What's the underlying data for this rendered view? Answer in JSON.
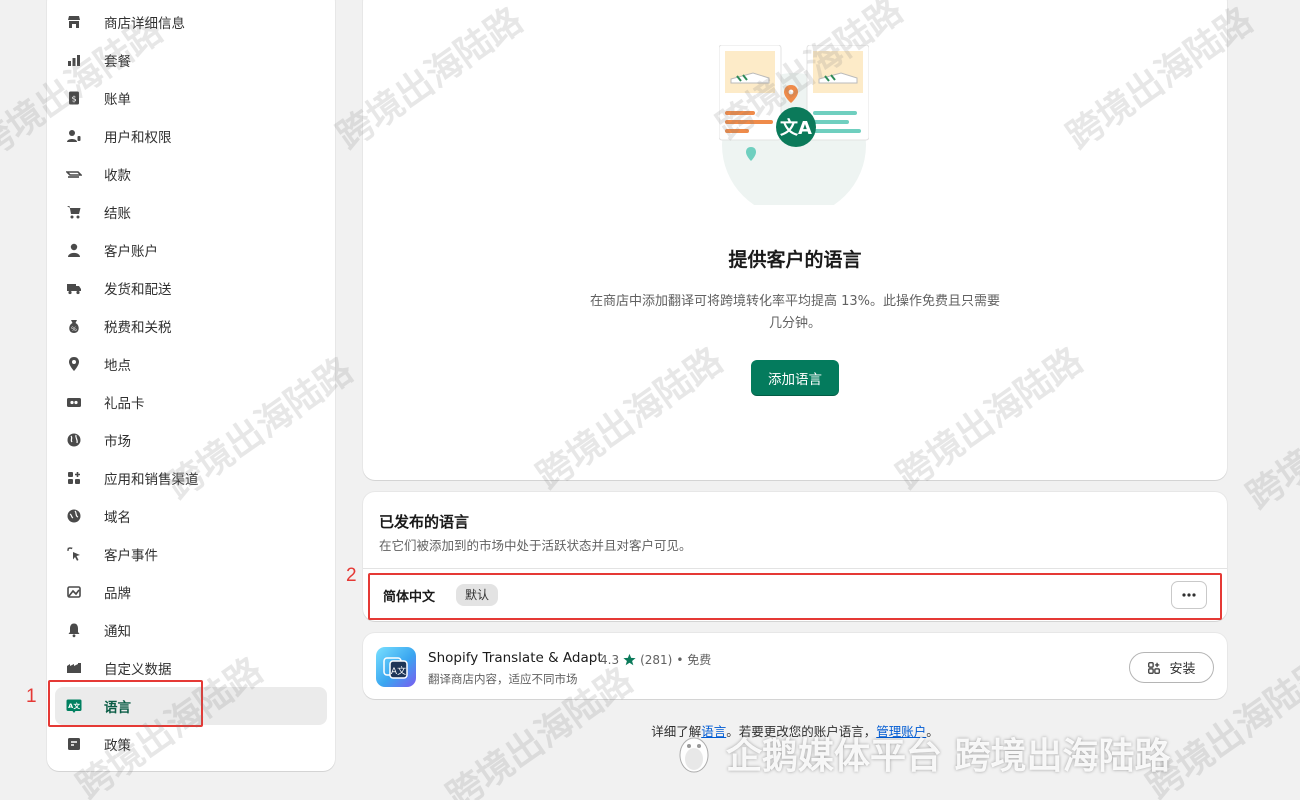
{
  "sidebar": {
    "items": [
      {
        "label": "商店详细信息",
        "icon": "store-icon"
      },
      {
        "label": "套餐",
        "icon": "plan-icon"
      },
      {
        "label": "账单",
        "icon": "billing-icon"
      },
      {
        "label": "用户和权限",
        "icon": "users-icon"
      },
      {
        "label": "收款",
        "icon": "payments-icon"
      },
      {
        "label": "结账",
        "icon": "checkout-cart-icon"
      },
      {
        "label": "客户账户",
        "icon": "customer-account-icon"
      },
      {
        "label": "发货和配送",
        "icon": "shipping-truck-icon"
      },
      {
        "label": "税费和关税",
        "icon": "taxes-icon"
      },
      {
        "label": "地点",
        "icon": "location-pin-icon"
      },
      {
        "label": "礼品卡",
        "icon": "gift-card-icon"
      },
      {
        "label": "市场",
        "icon": "markets-globe-icon"
      },
      {
        "label": "应用和销售渠道",
        "icon": "apps-icon"
      },
      {
        "label": "域名",
        "icon": "domains-globe-icon"
      },
      {
        "label": "客户事件",
        "icon": "customer-events-icon"
      },
      {
        "label": "品牌",
        "icon": "brand-icon"
      },
      {
        "label": "通知",
        "icon": "bell-icon"
      },
      {
        "label": "自定义数据",
        "icon": "custom-data-icon"
      },
      {
        "label": "语言",
        "icon": "language-icon",
        "active": true
      },
      {
        "label": "政策",
        "icon": "policies-icon"
      }
    ]
  },
  "hero": {
    "title": "提供客户的语言",
    "description": "在商店中添加翻译可将跨境转化率平均提高 13%。此操作免费且只需要几分钟。",
    "add_button": "添加语言"
  },
  "published": {
    "title": "已发布的语言",
    "subtitle": "在它们被添加到的市场中处于活跃状态并且对客户可见。",
    "languages": [
      {
        "name": "简体中文",
        "badge": "默认"
      }
    ]
  },
  "app": {
    "name": "Shopify Translate & Adapt",
    "rating": "4.3",
    "reviews": "(281)",
    "price": "• 免费",
    "description": "翻译商店内容，适应不同市场",
    "install_label": "安装"
  },
  "footer": {
    "prefix": "详细了解",
    "link1": "语言",
    "middle": "。若要更改您的账户语言，",
    "link2": "管理账户",
    "suffix": "。"
  },
  "annotations": {
    "one": "1",
    "two": "2"
  },
  "watermark": {
    "text": "跨境出海陆路",
    "bottom": "企鹅媒体平台 跨境出海陆路"
  },
  "colors": {
    "primary": "#047b5d",
    "annotation": "#e53935",
    "link": "#005bd3"
  }
}
